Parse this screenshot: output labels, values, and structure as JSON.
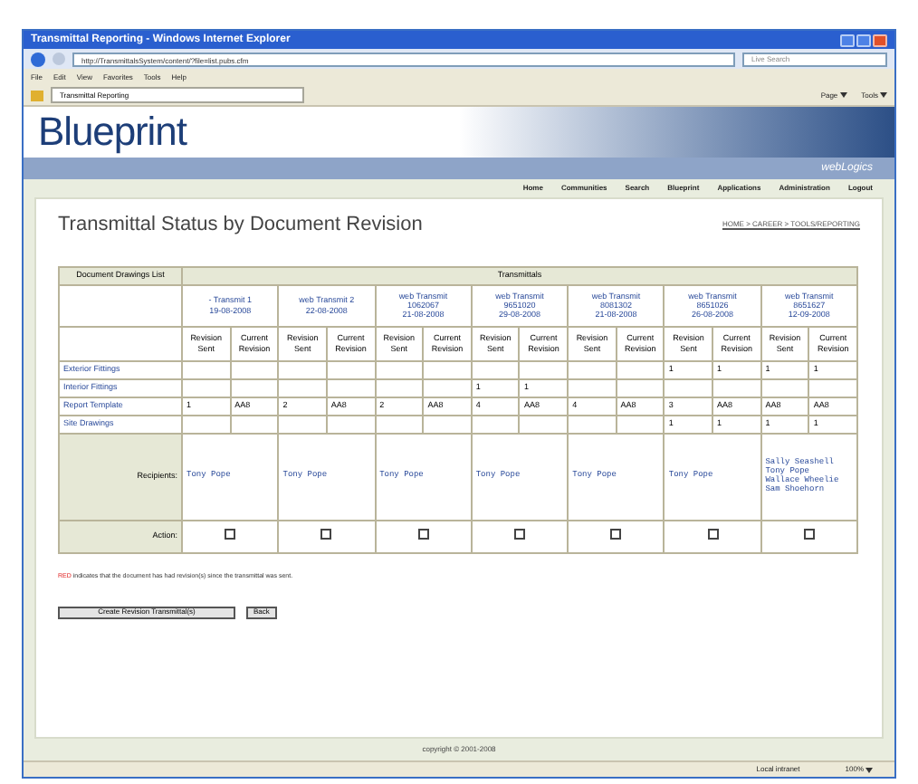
{
  "window": {
    "title": "Transmittal Reporting - Windows Internet Explorer"
  },
  "browser": {
    "address": "http://TransmittalsSystem/content/?file=list.pubs.cfm",
    "search_placeholder": "Live Search",
    "menu": [
      "File",
      "Edit",
      "View",
      "Favorites",
      "Tools",
      "Help"
    ],
    "tab": "Transmittal Reporting",
    "toolbar": [
      "Page",
      "Tools"
    ]
  },
  "header": {
    "logo": "Blueprint",
    "brand": "webLogics"
  },
  "nav": [
    "Home",
    "Communities",
    "Search",
    "Blueprint",
    "Applications",
    "Administration",
    "Logout"
  ],
  "page": {
    "title": "Transmittal Status by Document Revision",
    "breadcrumb": "HOME > CAREER > TOOLS/REPORTING"
  },
  "table": {
    "corner": "Document Drawings List",
    "group": "Transmittals",
    "transmittals": [
      {
        "lines": [
          "- Transmit 1",
          "19-08-2008"
        ],
        "sub_columns": [
          "Revision Sent",
          "Current Revision"
        ],
        "recipients": [
          "Tony Pope"
        ],
        "action_checked": false
      },
      {
        "lines": [
          "web Transmit 2",
          "22-08-2008"
        ],
        "sub_columns": [
          "Revision Sent",
          "Current Revision"
        ],
        "recipients": [
          "Tony Pope"
        ],
        "action_checked": false
      },
      {
        "lines": [
          "web Transmit",
          "1062067",
          "21-08-2008"
        ],
        "sub_columns": [
          "Revision Sent",
          "Current Revision"
        ],
        "recipients": [
          "Tony Pope"
        ],
        "action_checked": false
      },
      {
        "lines": [
          "web Transmit",
          "9651020",
          "29-08-2008"
        ],
        "sub_columns": [
          "Revision Sent",
          "Current Revision"
        ],
        "recipients": [
          "Tony Pope"
        ],
        "action_checked": false
      },
      {
        "lines": [
          "web Transmit",
          "8081302",
          "21-08-2008"
        ],
        "sub_columns": [
          "Revision Sent",
          "Current Revision"
        ],
        "recipients": [
          "Tony Pope"
        ],
        "action_checked": false
      },
      {
        "lines": [
          "web Transmit",
          "8651026",
          "26-08-2008"
        ],
        "sub_columns": [
          "Revision Sent",
          "Current Revision"
        ],
        "recipients": [
          "Tony Pope"
        ],
        "action_checked": false
      },
      {
        "lines": [
          "web Transmit",
          "8651627",
          "12-09-2008"
        ],
        "sub_columns": [
          "Revision Sent",
          "Current Revision"
        ],
        "recipients": [
          "Sally Seashell",
          "Tony Pope",
          "Wallace Wheelie",
          "Sam Shoehorn"
        ],
        "action_checked": false
      }
    ],
    "rows": [
      {
        "name": "Exterior Fittings",
        "cells": [
          null,
          null,
          null,
          null,
          null,
          null,
          null,
          null,
          null,
          null,
          "1",
          "1",
          "1",
          "1"
        ]
      },
      {
        "name": "Interior Fittings",
        "cells": [
          null,
          null,
          null,
          null,
          null,
          null,
          "1",
          "1",
          null,
          null,
          null,
          null,
          null,
          null
        ]
      },
      {
        "name": "Report Template",
        "cells": [
          "1",
          "AA8",
          "2",
          "AA8",
          "2",
          "AA8",
          "4",
          "AA8",
          "4",
          "AA8",
          "3",
          "AA8",
          "AA8",
          "AA8"
        ]
      },
      {
        "name": "Site Drawings",
        "cells": [
          null,
          null,
          null,
          null,
          null,
          null,
          null,
          null,
          null,
          null,
          "1",
          "1",
          "1",
          "1"
        ]
      }
    ],
    "recipients_label": "Recipients:",
    "action_label": "Action:"
  },
  "note": {
    "highlight": "RED",
    "text": "indicates that the document has had revision(s) since the transmittal was sent."
  },
  "buttons": [
    "Create Revision Transmittal(s)",
    "Back"
  ],
  "footer": "copyright © 2001-2008",
  "status_bar": {
    "zone": "Local intranet",
    "zoom": "100%"
  }
}
